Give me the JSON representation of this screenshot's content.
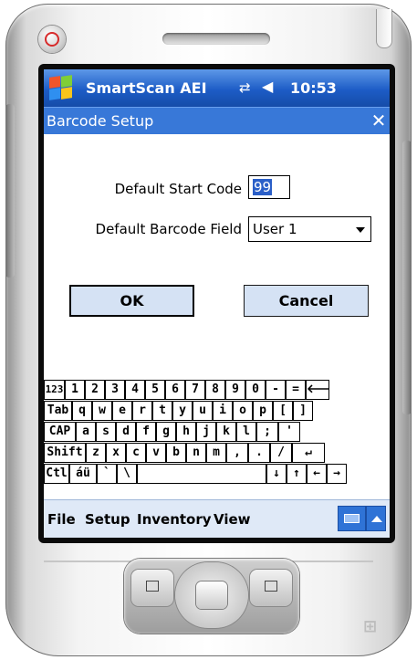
{
  "status_bar": {
    "app_title": "SmartScan AEI",
    "time": "10:53",
    "icons": [
      "windows-start-icon",
      "connectivity-icon",
      "volume-icon"
    ]
  },
  "dialog": {
    "title": "Barcode Setup",
    "close_label": "✕",
    "start_code_label": "Default Start Code",
    "start_code_value": "99",
    "barcode_field_label": "Default Barcode Field",
    "barcode_field_value": "User 1",
    "ok_label": "OK",
    "cancel_label": "Cancel"
  },
  "keyboard": {
    "rows": [
      [
        "123",
        "1",
        "2",
        "3",
        "4",
        "5",
        "6",
        "7",
        "8",
        "9",
        "0",
        "-",
        "=",
        "🡐"
      ],
      [
        "Tab",
        "q",
        "w",
        "e",
        "r",
        "t",
        "y",
        "u",
        "i",
        "o",
        "p",
        "[",
        "]"
      ],
      [
        "CAP",
        "a",
        "s",
        "d",
        "f",
        "g",
        "h",
        "j",
        "k",
        "l",
        ";",
        "'"
      ],
      [
        "Shift",
        "z",
        "x",
        "c",
        "v",
        "b",
        "n",
        "m",
        ",",
        ".",
        "/",
        "↵"
      ],
      [
        "Ctl",
        "áü",
        "`",
        "\\",
        "",
        "↓",
        "↑",
        "←",
        "→"
      ]
    ]
  },
  "menu": {
    "items": [
      "File",
      "Setup",
      "Inventory",
      "View"
    ]
  },
  "colors": {
    "title_bar": "#1d5cc6",
    "dialog_bar": "#3878d8",
    "button_face": "#d5e2f4",
    "menu_bar": "#dfe9f7"
  }
}
